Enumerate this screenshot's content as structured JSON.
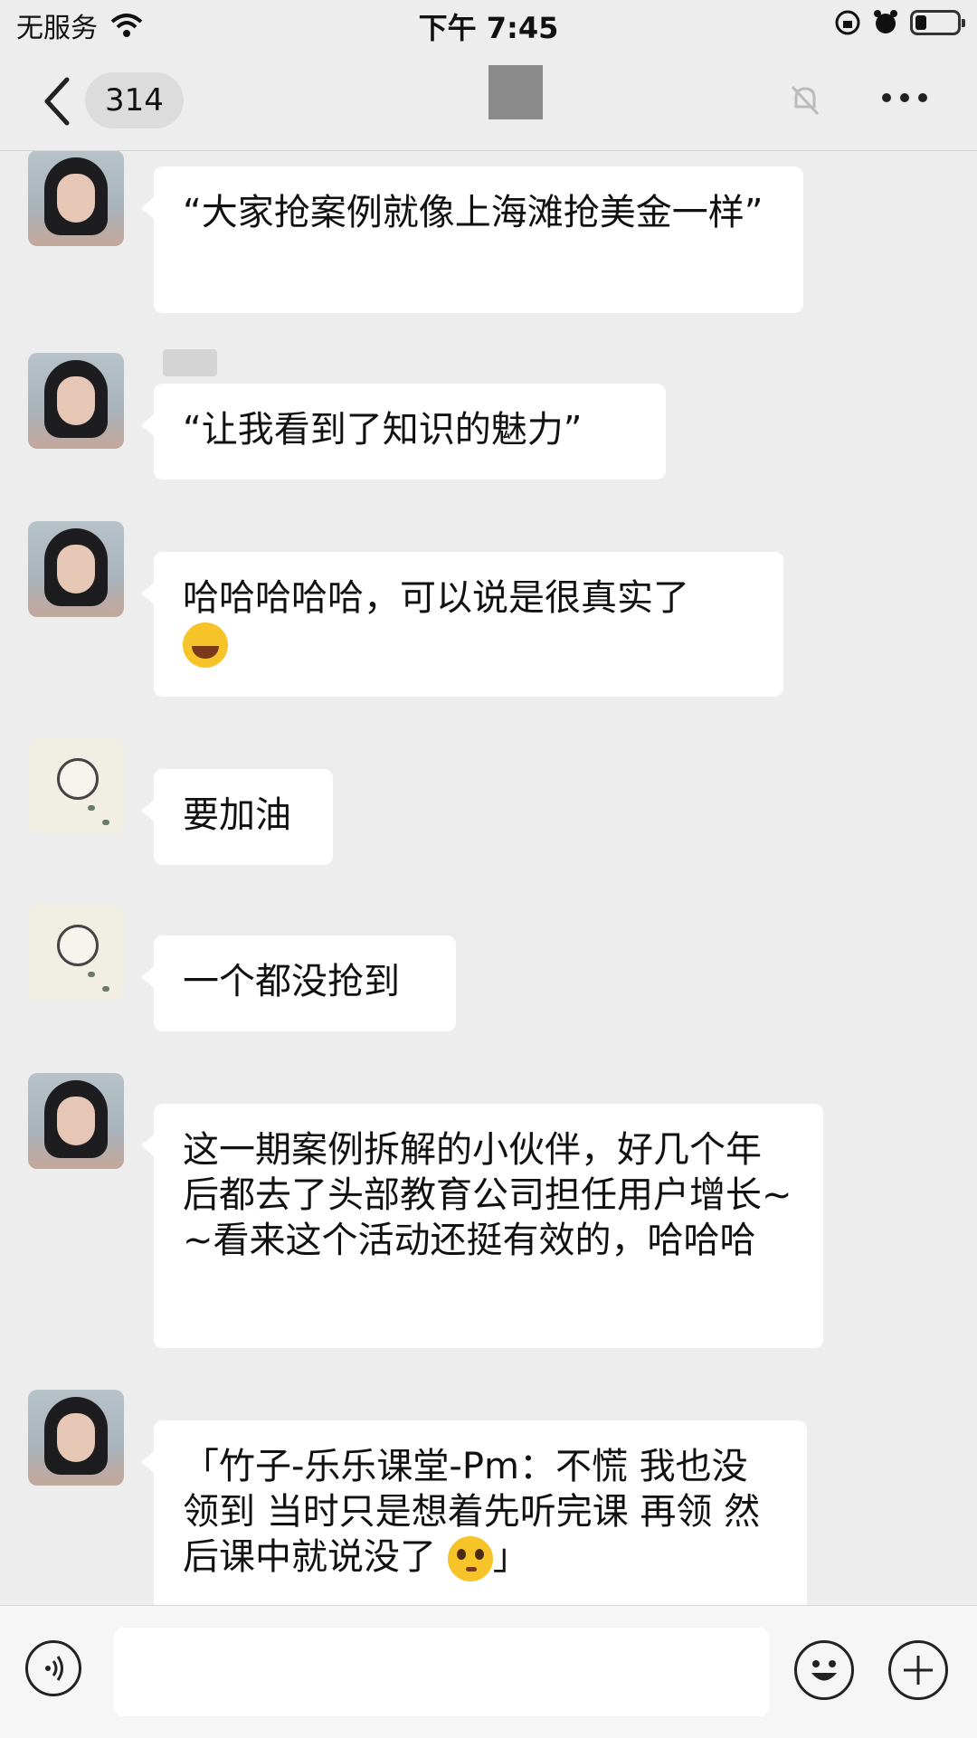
{
  "status_bar": {
    "carrier": "无服务",
    "time": "下午 7:45"
  },
  "nav": {
    "unread_count": "314"
  },
  "messages": [
    {
      "avatar": "girl-avatar",
      "text": "“大家抢案例就像上海滩抢美金一样”"
    },
    {
      "avatar": "girl-avatar",
      "text": "“让我看到了知识的魅力”"
    },
    {
      "avatar": "girl-avatar",
      "text": "哈哈哈哈哈，可以说是很真实了",
      "emoji": "tears-of-joy"
    },
    {
      "avatar": "baby-avatar",
      "text": "要加油"
    },
    {
      "avatar": "baby-avatar",
      "text": "一个都没抢到"
    },
    {
      "avatar": "girl-avatar",
      "text": "这一期案例拆解的小伙伴，好几个年后都去了头部教育公司担任用户增长~~看来这个活动还挺有效的，哈哈哈"
    },
    {
      "avatar": "girl-avatar",
      "text": "「竹子-乐乐课堂-Pm：不慌 我也没领到 当时只是想着先听完课 再领 然后课中就说没了",
      "emoji": "pleading-face",
      "text_end": "」"
    }
  ],
  "icons": {
    "wifi": "wifi-icon",
    "battery": "battery-icon",
    "back": "chevron-left-icon",
    "mute": "mute-bell-icon",
    "more": "more-dots-icon",
    "voice": "voice-icon",
    "emoji": "smiley-icon",
    "plus": "plus-icon"
  }
}
